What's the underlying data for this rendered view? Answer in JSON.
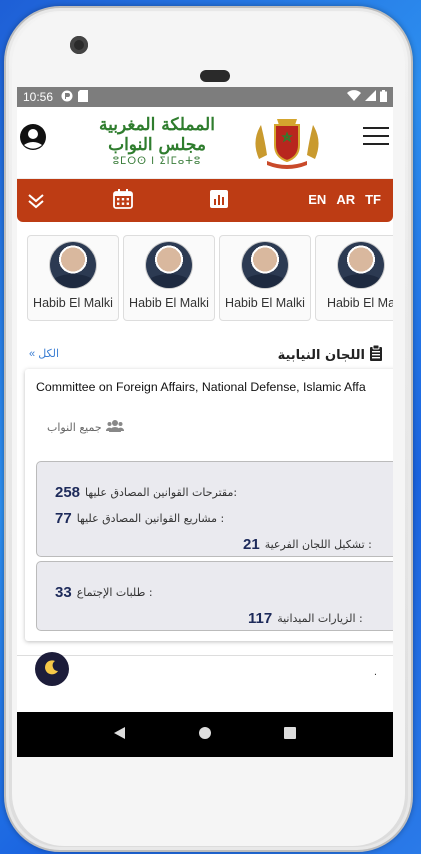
{
  "status_bar": {
    "time": "10:56"
  },
  "header": {
    "logo_line1": "المملكة المغربية",
    "logo_line2": "مجلس النواب",
    "logo_line3": "ⵓⵎⵔⵙ ⵏ ⵉⵏⵎⴰⵜⵓ"
  },
  "toolbar": {
    "languages": [
      "EN",
      "AR",
      "TF"
    ]
  },
  "members": [
    {
      "name": "Habib El Malki"
    },
    {
      "name": "Habib El Malki"
    },
    {
      "name": "Habib El Malki"
    },
    {
      "name": "Habib El Ma"
    }
  ],
  "section": {
    "title": "اللجان النيابية",
    "all_link": "الكل"
  },
  "committee": {
    "title": "Committee on Foreign Affairs, National Defense, Islamic Affa",
    "members_label": "جميع النواب",
    "stats": {
      "approved_proposals": {
        "label": "مقترحات القوانين المصادق عليها:",
        "value": "258"
      },
      "approved_bills": {
        "label": "مشاريع القوانين المصادق عليها :",
        "value": "77"
      },
      "subcommittees": {
        "label": "تشكيل اللجان الفرعية :",
        "value": "21"
      },
      "meeting_requests": {
        "label": "طلبات الإجتماع :",
        "value": "33"
      },
      "field_visits": {
        "label": "الزيارات الميدانية :",
        "value": "117"
      }
    }
  },
  "footer": {
    "dot": "."
  },
  "colors": {
    "toolbar": "#bd3c14",
    "logo_green": "#2f7d2e",
    "number": "#1d2a5a",
    "link": "#3d7fd3"
  }
}
